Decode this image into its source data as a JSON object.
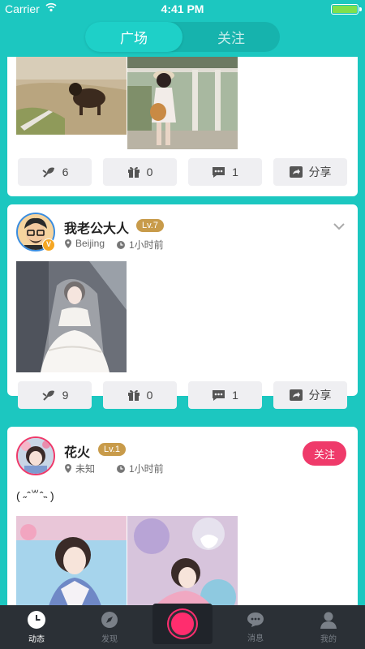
{
  "status_bar": {
    "carrier": "Carrier",
    "time": "4:41 PM"
  },
  "header": {
    "tabs": [
      {
        "label": "广场",
        "active": true
      },
      {
        "label": "关注",
        "active": false
      }
    ]
  },
  "feed": {
    "posts": [
      {
        "actions": {
          "likes": "6",
          "gifts": "0",
          "comments": "1",
          "share": "分享"
        }
      },
      {
        "username": "我老公大人",
        "level": "Lv.7",
        "location": "Beijing",
        "time": "1小时前",
        "actions": {
          "likes": "9",
          "gifts": "0",
          "comments": "1",
          "share": "分享"
        }
      },
      {
        "username": "花火",
        "level": "Lv.1",
        "location": "未知",
        "time": "1小时前",
        "follow_label": "关注",
        "text": "( ˶ˆ꒳ˆ˵ )"
      }
    ]
  },
  "tab_bar": {
    "items": [
      {
        "label": "动态",
        "icon": "clock-icon",
        "active": true
      },
      {
        "label": "发现",
        "icon": "compass-icon",
        "active": false
      },
      {
        "label": "",
        "icon": "record-button",
        "active": false
      },
      {
        "label": "消息",
        "icon": "chat-icon",
        "active": false
      },
      {
        "label": "我的",
        "icon": "person-icon",
        "active": false
      }
    ]
  },
  "colors": {
    "accent": "#1cc7c0",
    "follow": "#ef3a6a",
    "level_badge": "#c89b4a",
    "tabbar": "#2b3036"
  }
}
